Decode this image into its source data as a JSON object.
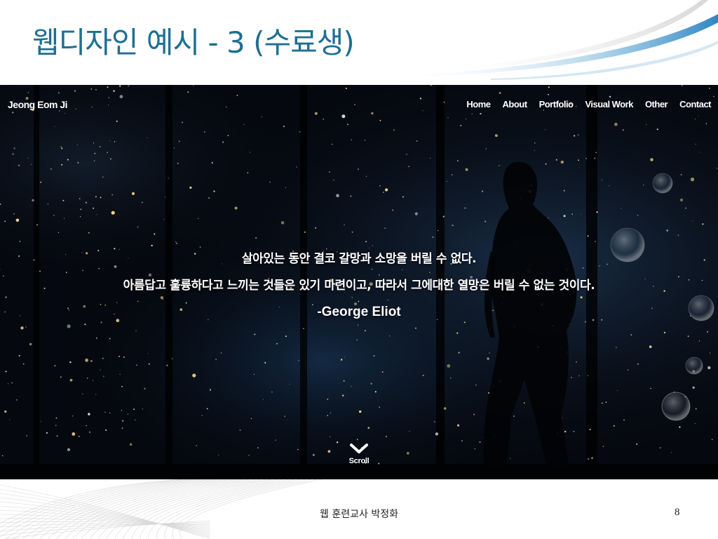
{
  "slide": {
    "title": "웹디자인 예시 - 3 (수료생)",
    "footer": "웹 훈련교사 박정화",
    "page_number": "8"
  },
  "site": {
    "logo": "Jeong Eom Ji",
    "nav": [
      "Home",
      "About",
      "Portfolio",
      "Visual Work",
      "Other",
      "Contact"
    ],
    "quote_lines": [
      "살아있는 동안 결코 갈망과 소망을 버릴 수 없다.",
      "아름답고 훌륭하다고 느끼는 것들은 있기 마련이고, 따라서 그에대한 열망은 버릴 수 없는 것이다."
    ],
    "quote_author": "-George Eliot",
    "scroll_label": "Scroll",
    "scroll_icon": "chevron-down-icon"
  },
  "colors": {
    "title": "#1e6f93",
    "hero_bg": "#05080f",
    "accent_swoosh": "#5aa9d6"
  }
}
